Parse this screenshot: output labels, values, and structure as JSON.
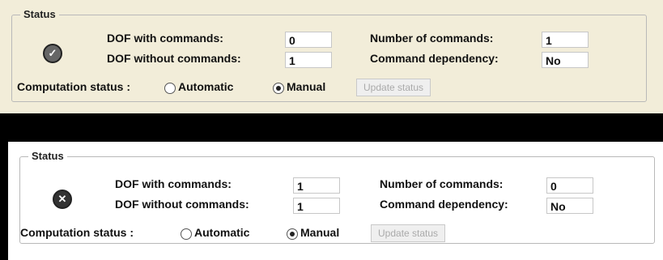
{
  "panels": [
    {
      "legend": "Status",
      "status_icon": "check-circle-icon",
      "dof_with_label": "DOF with commands:",
      "dof_with_value": "0",
      "dof_without_label": "DOF without commands:",
      "dof_without_value": "1",
      "num_commands_label": "Number of commands:",
      "num_commands_value": "1",
      "dependency_label": "Command dependency:",
      "dependency_value": "No",
      "computation_label": "Computation status :",
      "automatic_label": "Automatic",
      "manual_label": "Manual",
      "selected_mode": "Manual",
      "update_label": "Update status"
    },
    {
      "legend": "Status",
      "status_icon": "x-circle-icon",
      "dof_with_label": "DOF with commands:",
      "dof_with_value": "1",
      "dof_without_label": "DOF without commands:",
      "dof_without_value": "1",
      "num_commands_label": "Number of commands:",
      "num_commands_value": "0",
      "dependency_label": "Command dependency:",
      "dependency_value": "No",
      "computation_label": "Computation status :",
      "automatic_label": "Automatic",
      "manual_label": "Manual",
      "selected_mode": "Manual",
      "update_label": "Update status"
    }
  ],
  "colors": {
    "top_panel_bg": "#f2edd9",
    "bottom_panel_bg": "#ffffff",
    "separator": "#000000"
  }
}
